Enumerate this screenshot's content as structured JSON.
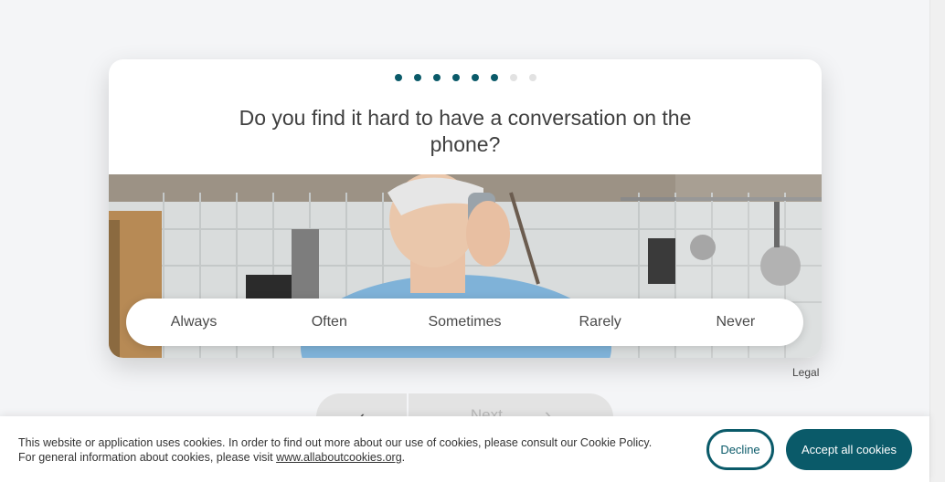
{
  "progress": {
    "total_steps": 8,
    "completed_steps": 6,
    "active_color": "#0a5a69",
    "inactive_color": "#e2e2e2"
  },
  "question": {
    "text": "Do you find it hard to have a conversation on the phone?"
  },
  "image": {
    "description_icon": "woman-on-phone-photo"
  },
  "answers": [
    {
      "label": "Always"
    },
    {
      "label": "Often"
    },
    {
      "label": "Sometimes"
    },
    {
      "label": "Rarely"
    },
    {
      "label": "Never"
    }
  ],
  "footer": {
    "legal_label": "Legal"
  },
  "navigation": {
    "back_icon": "chevron-left-icon",
    "back_glyph": "‹",
    "next_label": "Next",
    "next_glyph": "›"
  },
  "cookie_banner": {
    "text_part1": "This website or application uses cookies. In order to find out more about our use of cookies, please consult our Cookie Policy. For general information about cookies, please visit ",
    "link_label": "www.allaboutcookies.org",
    "text_part2": ".",
    "decline_label": "Decline",
    "accept_label": "Accept all cookies",
    "brand_color": "#0a5a69"
  }
}
